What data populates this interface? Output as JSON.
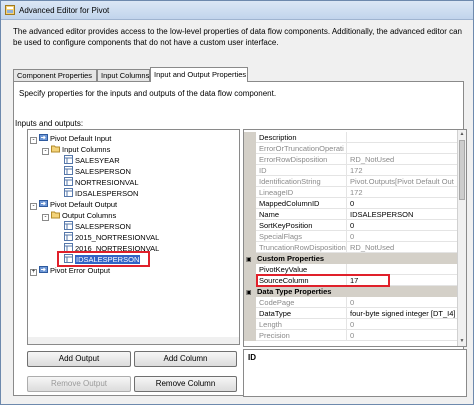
{
  "window": {
    "title": "Advanced Editor for Pivot"
  },
  "description": "The advanced editor provides access to the low-level properties of data flow components. Additionally, the advanced editor can be used to configure components that do not have a custom user interface.",
  "tabs": [
    {
      "label": "Component Properties",
      "active": false
    },
    {
      "label": "Input Columns",
      "active": false
    },
    {
      "label": "Input and Output Properties",
      "active": true
    }
  ],
  "panel": {
    "description": "Specify properties for the inputs and outputs of the data flow component.",
    "io_label": "Inputs and outputs:"
  },
  "tree": {
    "nodes": [
      {
        "label": "Pivot Default Input",
        "expander": "-"
      },
      {
        "label": "Input Columns",
        "expander": "-"
      },
      {
        "label": "SALESYEAR"
      },
      {
        "label": "SALESPERSON"
      },
      {
        "label": "NORTRESIONVAL"
      },
      {
        "label": "IDSALESPERSON"
      },
      {
        "label": "Pivot Default Output",
        "expander": "-"
      },
      {
        "label": "Output Columns",
        "expander": "-"
      },
      {
        "label": "SALESPERSON"
      },
      {
        "label": "2015_NORTRESIONVAL"
      },
      {
        "label": "2016_NORTRESIONVAL"
      },
      {
        "label": "IDSALESPERSON",
        "selected": true
      },
      {
        "label": "Pivot Error Output",
        "expander": "+"
      }
    ]
  },
  "properties": {
    "rows": [
      {
        "name": "Description",
        "value": ""
      },
      {
        "name": "ErrorOrTruncationOperati",
        "value": "",
        "readonly": true
      },
      {
        "name": "ErrorRowDisposition",
        "value": "RD_NotUsed",
        "readonly": true
      },
      {
        "name": "ID",
        "value": "172",
        "readonly": true
      },
      {
        "name": "IdentificationString",
        "value": "Pivot.Outputs[Pivot Default Out",
        "readonly": true
      },
      {
        "name": "LineageID",
        "value": "172",
        "readonly": true
      },
      {
        "name": "MappedColumnID",
        "value": "0"
      },
      {
        "name": "Name",
        "value": "IDSALESPERSON"
      },
      {
        "name": "SortKeyPosition",
        "value": "0"
      },
      {
        "name": "SpecialFlags",
        "value": "0",
        "readonly": true
      },
      {
        "name": "TruncationRowDisposition",
        "value": "RD_NotUsed",
        "readonly": true
      }
    ],
    "custom_category": "Custom Properties",
    "custom_rows": [
      {
        "name": "PivotKeyValue",
        "value": ""
      },
      {
        "name": "SourceColumn",
        "value": "17"
      }
    ],
    "datatype_category": "Data Type Properties",
    "datatype_rows": [
      {
        "name": "CodePage",
        "value": "0",
        "readonly": true
      },
      {
        "name": "DataType",
        "value": "four-byte signed integer [DT_I4]"
      },
      {
        "name": "Length",
        "value": "0",
        "readonly": true
      },
      {
        "name": "Precision",
        "value": "0",
        "readonly": true
      }
    ],
    "category_toggle": "▣"
  },
  "description_box": {
    "title": "ID"
  },
  "buttons": {
    "add_output": "Add Output",
    "add_column": "Add Column",
    "remove_output": "Remove Output",
    "remove_column": "Remove Column"
  },
  "colors": {
    "highlight_red": "#e0202a",
    "selection_blue": "#3163c5"
  }
}
